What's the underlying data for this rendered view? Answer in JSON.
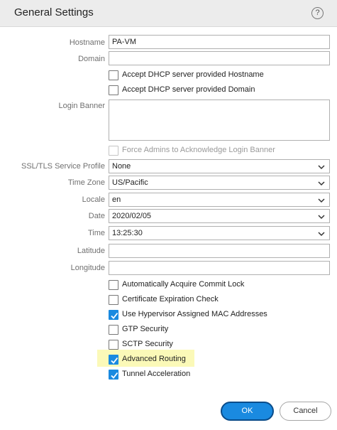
{
  "dialog": {
    "title": "General Settings",
    "help_glyph": "?"
  },
  "fields": {
    "hostname": {
      "label": "Hostname",
      "value": "PA-VM"
    },
    "domain": {
      "label": "Domain",
      "value": ""
    },
    "login_banner": {
      "label": "Login Banner",
      "value": ""
    },
    "ssl_tls": {
      "label": "SSL/TLS Service Profile",
      "value": "None"
    },
    "time_zone": {
      "label": "Time Zone",
      "value": "US/Pacific"
    },
    "locale": {
      "label": "Locale",
      "value": "en"
    },
    "date": {
      "label": "Date",
      "value": "2020/02/05"
    },
    "time": {
      "label": "Time",
      "value": "13:25:30"
    },
    "latitude": {
      "label": "Latitude",
      "value": ""
    },
    "longitude": {
      "label": "Longitude",
      "value": ""
    }
  },
  "checkboxes": {
    "dhcp_hostname": {
      "label": "Accept DHCP server provided Hostname",
      "checked": false
    },
    "dhcp_domain": {
      "label": "Accept DHCP server provided Domain",
      "checked": false
    },
    "force_banner": {
      "label": "Force Admins to Acknowledge Login Banner",
      "checked": false,
      "disabled": true
    },
    "commit_lock": {
      "label": "Automatically Acquire Commit Lock",
      "checked": false
    },
    "cert_check": {
      "label": "Certificate Expiration Check",
      "checked": false
    },
    "hypervisor_mac": {
      "label": "Use Hypervisor Assigned MAC Addresses",
      "checked": true
    },
    "gtp_security": {
      "label": "GTP Security",
      "checked": false
    },
    "sctp_security": {
      "label": "SCTP Security",
      "checked": false
    },
    "advanced_routing": {
      "label": "Advanced Routing",
      "checked": true,
      "highlighted": true
    },
    "tunnel_accel": {
      "label": "Tunnel Acceleration",
      "checked": true
    }
  },
  "buttons": {
    "ok": "OK",
    "cancel": "Cancel"
  },
  "colors": {
    "accent": "#1a8ae0",
    "highlight": "#fbf9b8"
  }
}
